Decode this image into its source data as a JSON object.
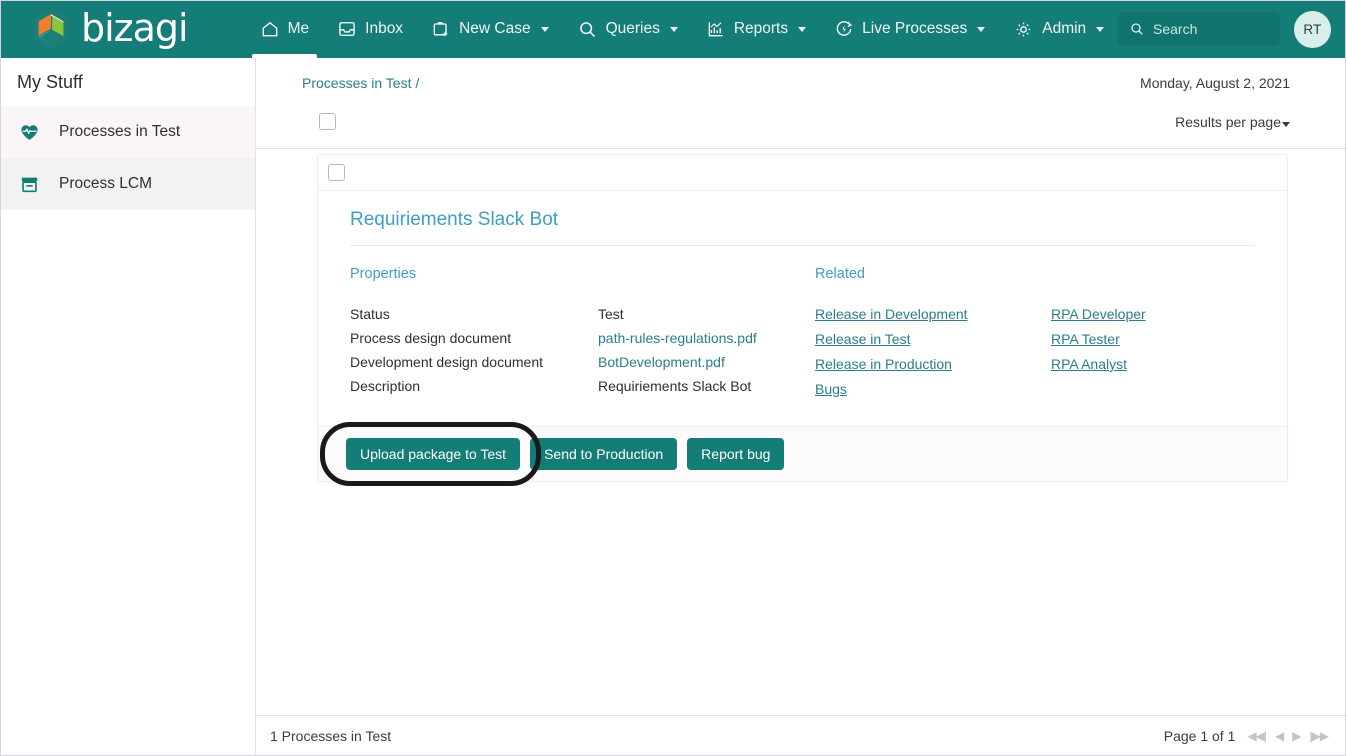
{
  "brand": {
    "name": "bizagi",
    "teal": "#147d77",
    "link_teal": "#2a7e8b",
    "title_blue": "#3f9ec4"
  },
  "topnav": {
    "items": [
      {
        "label": "Me",
        "icon": "home-icon",
        "active": true,
        "has_caret": false
      },
      {
        "label": "Inbox",
        "icon": "inbox-icon",
        "active": false,
        "has_caret": false
      },
      {
        "label": "New Case",
        "icon": "new-case-icon",
        "active": false,
        "has_caret": true
      },
      {
        "label": "Queries",
        "icon": "search-icon",
        "active": false,
        "has_caret": true
      },
      {
        "label": "Reports",
        "icon": "chart-icon",
        "active": false,
        "has_caret": true
      },
      {
        "label": "Live Processes",
        "icon": "live-processes-icon",
        "active": false,
        "has_caret": true
      },
      {
        "label": "Admin",
        "icon": "gear-icon",
        "active": false,
        "has_caret": true
      }
    ],
    "search": {
      "placeholder": "Search",
      "icon": "search-icon"
    },
    "avatar": {
      "initials": "RT"
    }
  },
  "sidebar": {
    "header": "My Stuff",
    "items": [
      {
        "label": "Processes in Test",
        "icon": "heart-pulse-icon"
      },
      {
        "label": "Process LCM",
        "icon": "archive-box-icon"
      }
    ]
  },
  "header": {
    "breadcrumb": "Processes in Test /",
    "date": "Monday, August 2, 2021",
    "results_per_page": "Results per page"
  },
  "card": {
    "title": "Requiriements Slack Bot",
    "properties_heading": "Properties",
    "properties": [
      {
        "key": "Status",
        "value": "Test",
        "is_link": false
      },
      {
        "key": "Process design document",
        "value": "path-rules-regulations.pdf",
        "is_link": true
      },
      {
        "key": "Development design document",
        "value": "BotDevelopment.pdf",
        "is_link": true
      },
      {
        "key": "Description",
        "value": "Requiriements Slack Bot",
        "is_link": false
      }
    ],
    "related_heading": "Related",
    "related_left": [
      "Release in Development",
      "Release in Test",
      "Release in Production",
      "Bugs"
    ],
    "related_right": [
      "RPA Developer",
      "RPA Tester",
      "RPA Analyst"
    ],
    "buttons": [
      {
        "label": "Upload package to Test",
        "highlighted": true
      },
      {
        "label": "Send to Production",
        "highlighted": false
      },
      {
        "label": "Report bug",
        "highlighted": false
      }
    ]
  },
  "footer": {
    "count_text": "1 Processes in Test",
    "page_text": "Page 1 of 1",
    "pager_icons": [
      "first-page-icon",
      "prev-page-icon",
      "next-page-icon",
      "last-page-icon"
    ]
  }
}
